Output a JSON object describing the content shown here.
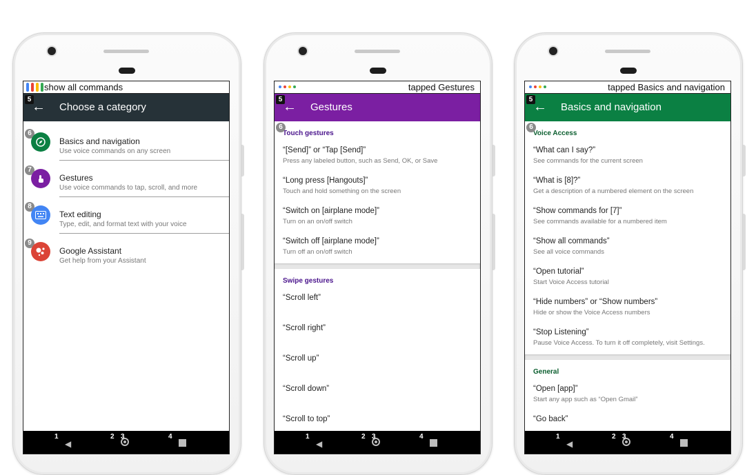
{
  "phone1": {
    "status_text": "show all commands",
    "toolbar_title": "Choose a category",
    "toolbar_color": "#263238",
    "toolbar_badge": "5",
    "categories": [
      {
        "badge": "6",
        "title": "Basics and navigation",
        "subtitle": "Use voice commands on any screen",
        "icon": "compass-icon",
        "color": "#0b8043"
      },
      {
        "badge": "7",
        "title": "Gestures",
        "subtitle": "Use voice commands to tap, scroll, and more",
        "icon": "touch-icon",
        "color": "#7b1fa2"
      },
      {
        "badge": "8",
        "title": "Text editing",
        "subtitle": "Type, edit, and format text with your voice",
        "icon": "keyboard-icon",
        "color": "#4285f4"
      },
      {
        "badge": "9",
        "title": "Google Assistant",
        "subtitle": "Get help from your Assistant",
        "icon": "assistant-icon",
        "color": "#db4437"
      }
    ]
  },
  "phone2": {
    "status_text": "tapped Gestures",
    "toolbar_title": "Gestures",
    "toolbar_color": "#7b1fa2",
    "toolbar_badge": "5",
    "section_badge": "6",
    "section_color": "#4a148c",
    "sections": [
      {
        "label": "Touch gestures",
        "commands": [
          {
            "title": "“[Send]” or “Tap [Send]”",
            "subtitle": "Press any labeled button, such as Send, OK, or Save"
          },
          {
            "title": "“Long press [Hangouts]”",
            "subtitle": "Touch and hold something on the screen"
          },
          {
            "title": "“Switch on [airplane mode]”",
            "subtitle": "Turn on an on/off switch"
          },
          {
            "title": "“Switch off [airplane mode]”",
            "subtitle": "Turn off an on/off switch"
          }
        ]
      },
      {
        "label": "Swipe gestures",
        "commands": [
          {
            "title": "“Scroll left”",
            "subtitle": ""
          },
          {
            "title": "“Scroll right”",
            "subtitle": ""
          },
          {
            "title": "“Scroll up”",
            "subtitle": ""
          },
          {
            "title": "“Scroll down”",
            "subtitle": ""
          },
          {
            "title": "“Scroll to top”",
            "subtitle": ""
          }
        ]
      }
    ]
  },
  "phone3": {
    "status_text": "tapped Basics and navigation",
    "toolbar_title": "Basics and navigation",
    "toolbar_color": "#0b8043",
    "toolbar_badge": "5",
    "section_badge": "6",
    "section_color": "#0b5e2f",
    "sections": [
      {
        "label": "Voice Access",
        "commands": [
          {
            "title": "“What can I say?”",
            "subtitle": "See commands for the current screen"
          },
          {
            "title": "“What is [8]?”",
            "subtitle": "Get a description of a numbered element on the screen"
          },
          {
            "title": "“Show commands for [7]”",
            "subtitle": "See commands available for a numbered item"
          },
          {
            "title": "“Show all commands”",
            "subtitle": "See all voice commands"
          },
          {
            "title": "“Open tutorial”",
            "subtitle": "Start Voice Access tutorial"
          },
          {
            "title": "“Hide numbers” or “Show numbers”",
            "subtitle": "Hide or show the Voice Access numbers"
          },
          {
            "title": "“Stop Listening”",
            "subtitle": "Pause Voice Access. To turn it off completely, visit Settings."
          }
        ]
      },
      {
        "label": "General",
        "commands": [
          {
            "title": "“Open [app]”",
            "subtitle": "Start any app such as “Open Gmail”"
          },
          {
            "title": "“Go back”",
            "subtitle": ""
          }
        ]
      }
    ]
  },
  "navbar": {
    "n1": "1",
    "n2": "2",
    "n3": "3",
    "n4": "4"
  },
  "brand_colors": {
    "blue": "#4285f4",
    "red": "#ea4335",
    "yellow": "#fbbc05",
    "green": "#34a853"
  }
}
